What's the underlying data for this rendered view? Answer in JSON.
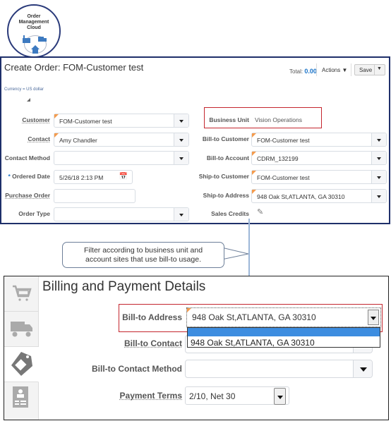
{
  "logo": {
    "line1": "Order",
    "line2": "Management",
    "line3": "Cloud"
  },
  "header": {
    "title": "Create Order: FOM-Customer test",
    "total_label": "Total:",
    "total_value": "0.00",
    "actions_label": "Actions",
    "save_label": "Save",
    "currency_note": "Currency = US dollar"
  },
  "form_left": [
    {
      "label": "Customer",
      "value": "FOM-Customer test",
      "type": "select"
    },
    {
      "label": "Contact",
      "value": "Amy Chandler",
      "type": "select"
    },
    {
      "label": "Contact Method",
      "value": "",
      "type": "select"
    },
    {
      "label": "Ordered Date",
      "value": "5/26/18 2:13 PM",
      "type": "date",
      "required_marker": "*"
    },
    {
      "label": "Purchase Order",
      "value": "",
      "type": "text"
    },
    {
      "label": "Order Type",
      "value": "",
      "type": "select"
    }
  ],
  "form_right": [
    {
      "label": "Business Unit",
      "value": "Vision Operations",
      "type": "readonly"
    },
    {
      "label": "Bill-to Customer",
      "value": "FOM-Customer test",
      "type": "select"
    },
    {
      "label": "Bill-to Account",
      "value": "CDRM_132199",
      "type": "select"
    },
    {
      "label": "Ship-to Customer",
      "value": "FOM-Customer test",
      "type": "select"
    },
    {
      "label": "Ship-to Address",
      "value": "948 Oak St,ATLANTA, GA 30310",
      "type": "select"
    },
    {
      "label": "Sales Credits",
      "value": "",
      "type": "edit"
    }
  ],
  "callout": {
    "line1": "Filter according to business unit and",
    "line2": "account sites that use bill-to usage."
  },
  "billing": {
    "section_title": "Billing and Payment Details",
    "side_tabs": [
      "cart-icon",
      "truck-icon",
      "tag-icon",
      "contact-card-icon"
    ],
    "bill_to_address_label": "Bill-to Address",
    "bill_to_address_value": "948 Oak St,ATLANTA, GA 30310",
    "dropdown_options": [
      "",
      "948 Oak St,ATLANTA, GA 30310"
    ],
    "bill_to_contact_label": "Bill-to Contact",
    "bill_to_contact_method_label": "Bill-to Contact Method",
    "bill_to_contact_method_value": "",
    "payment_terms_label": "Payment Terms",
    "payment_terms_value": "2/10, Net 30"
  }
}
